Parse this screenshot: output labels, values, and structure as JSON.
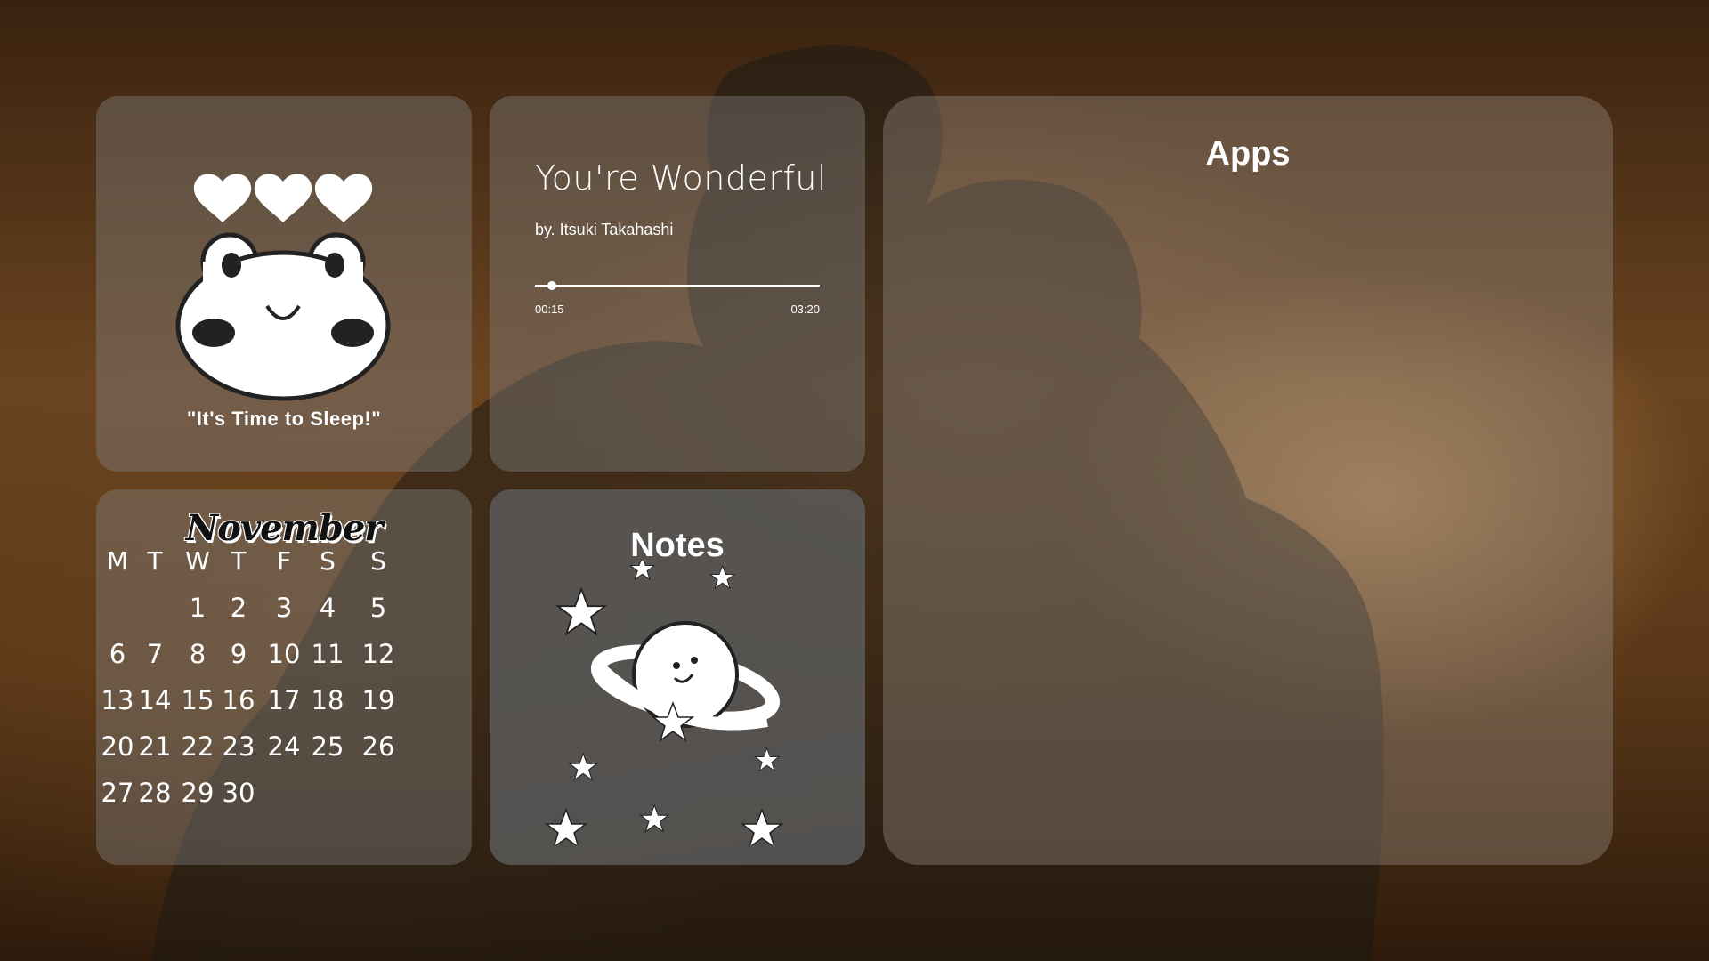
{
  "frog_widget": {
    "caption": "\"It's Time to Sleep!\""
  },
  "music_widget": {
    "title": "You're Wonderful",
    "artist": "by. Itsuki Takahashi",
    "current_time": "00:15",
    "total_time": "03:20",
    "progress": 0.06
  },
  "apps_widget": {
    "title": "Apps"
  },
  "calendar_widget": {
    "month": "November",
    "weekdays": [
      "M",
      "T",
      "W",
      "T",
      "F",
      "S",
      "S"
    ],
    "weeks": [
      [
        "",
        "",
        "1",
        "2",
        "3",
        "4",
        "5"
      ],
      [
        "6",
        "7",
        "8",
        "9",
        "10",
        "11",
        "12"
      ],
      [
        "13",
        "14",
        "15",
        "16",
        "17",
        "18",
        "19"
      ],
      [
        "20",
        "21",
        "22",
        "23",
        "24",
        "25",
        "26"
      ],
      [
        "27",
        "28",
        "29",
        "30",
        "",
        "",
        ""
      ]
    ]
  },
  "notes_widget": {
    "title": "Notes"
  },
  "icons": [
    "heart-icon",
    "frog-face-icon",
    "planet-icon",
    "star-icon"
  ],
  "colors": {
    "widget_bg": "#808080",
    "text": "#ffffff"
  }
}
